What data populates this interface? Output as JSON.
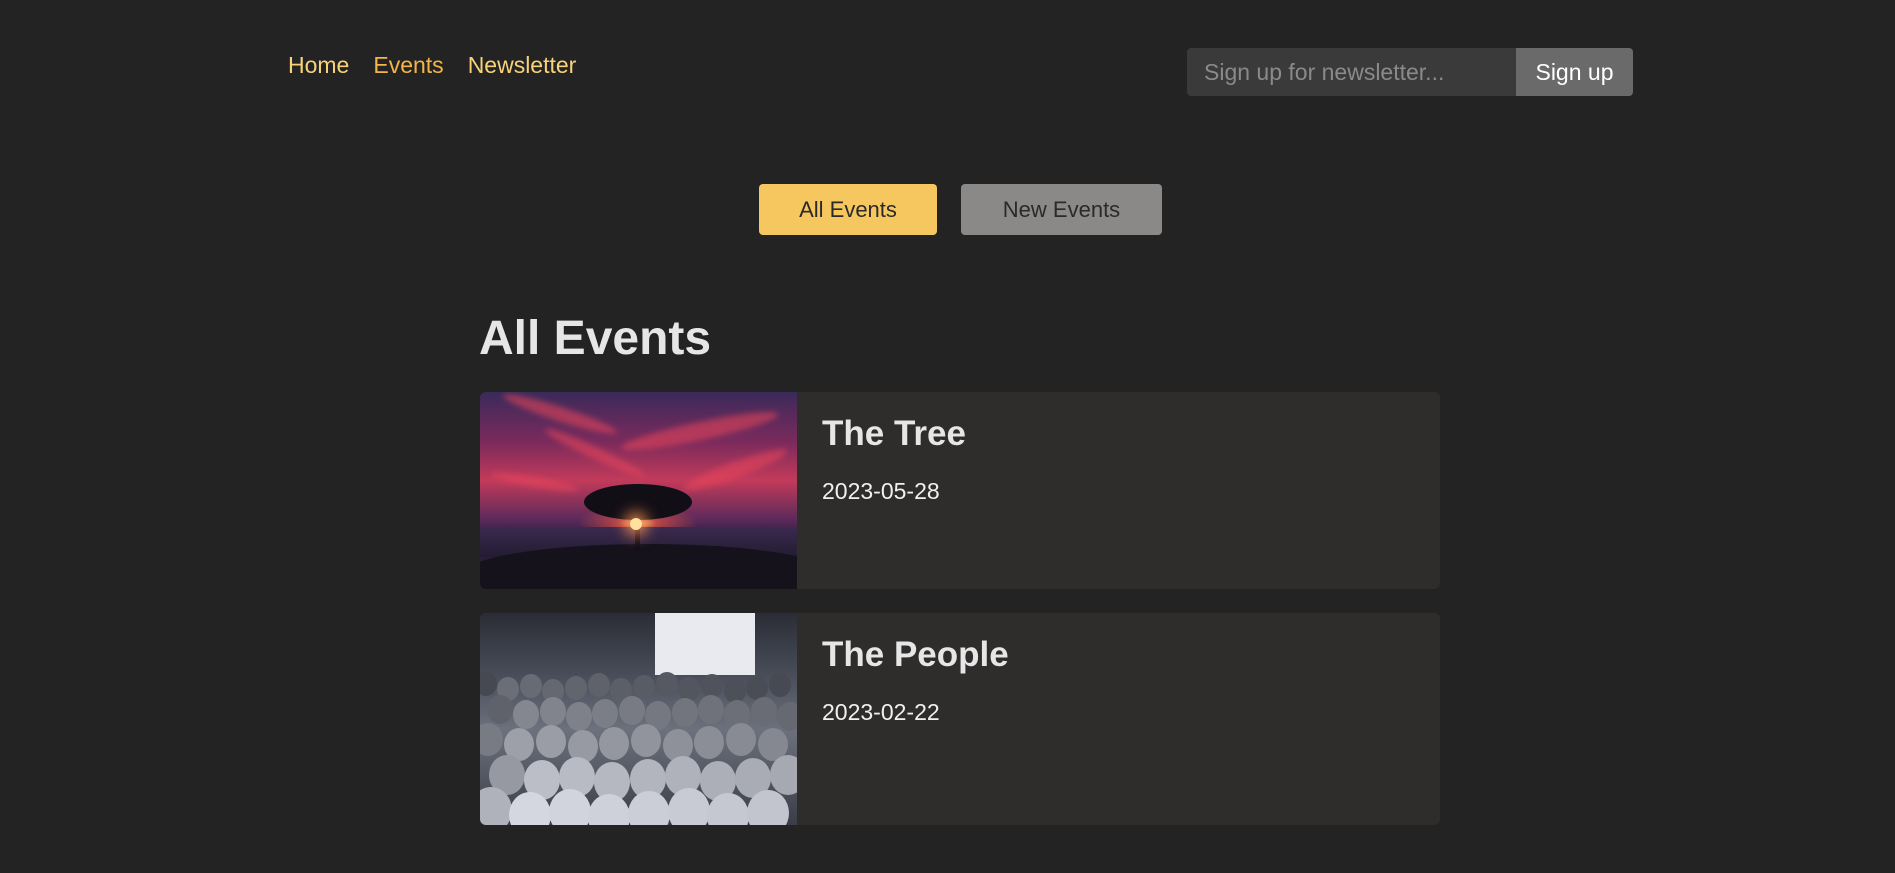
{
  "nav": {
    "items": [
      {
        "label": "Home",
        "active": false
      },
      {
        "label": "Events",
        "active": true
      },
      {
        "label": "Newsletter",
        "active": false
      }
    ]
  },
  "newsletter": {
    "placeholder": "Sign up for newsletter...",
    "value": "",
    "button_label": "Sign up"
  },
  "filters": {
    "all_label": "All Events",
    "new_label": "New Events",
    "selected": "All Events"
  },
  "main": {
    "title": "All Events",
    "events": [
      {
        "title": "The Tree",
        "date": "2023-05-28",
        "image": "tree-sunset-image"
      },
      {
        "title": "The People",
        "date": "2023-02-22",
        "image": "audience-crowd-image"
      }
    ]
  },
  "colors": {
    "background": "#232323",
    "accent": "#f7c75f",
    "nav_link": "#f7d27a",
    "nav_active": "#f4b544",
    "card_background": "#2f2d2c"
  }
}
